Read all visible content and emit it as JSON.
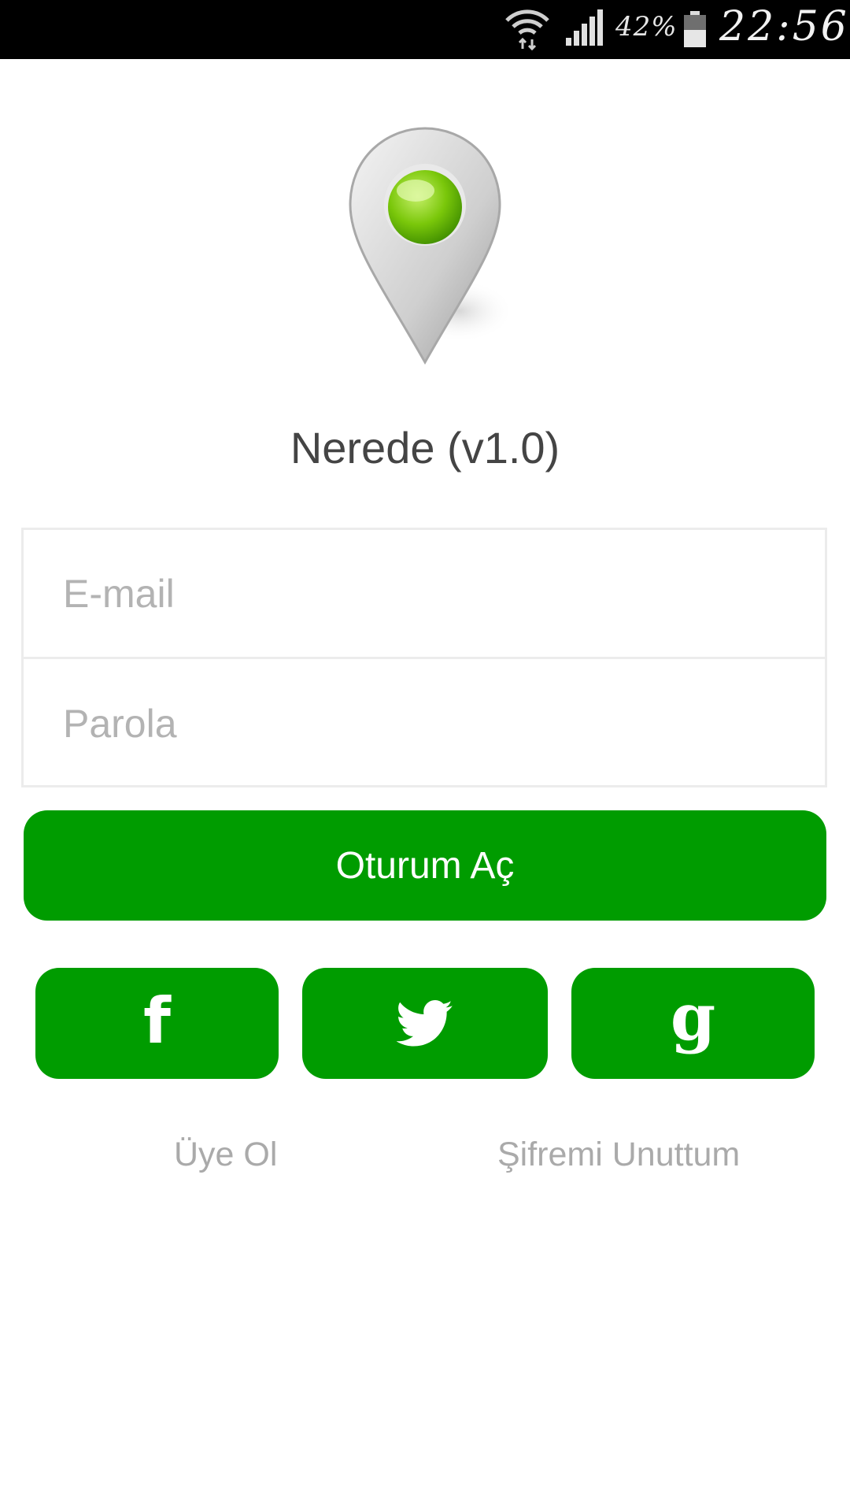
{
  "status_bar": {
    "battery_percent": "42%",
    "time": "22:56",
    "icons": [
      "wifi-icon",
      "signal-icon",
      "battery-icon"
    ]
  },
  "app": {
    "title": "Nerede (v1.0)",
    "logo": "map-pin-logo"
  },
  "form": {
    "email_placeholder": "E-mail",
    "password_placeholder": "Parola"
  },
  "login_button_label": "Oturum Aç",
  "social": {
    "facebook_icon": "facebook-icon",
    "twitter_icon": "twitter-icon",
    "google_icon": "google-icon"
  },
  "links": {
    "signup": "Üye Ol",
    "forgot_password": "Şifremi Unuttum"
  },
  "colors": {
    "primary_green": "#009c00",
    "status_bar": "#000000",
    "placeholder": "#b3b3b3",
    "link": "#aaaaaa"
  }
}
